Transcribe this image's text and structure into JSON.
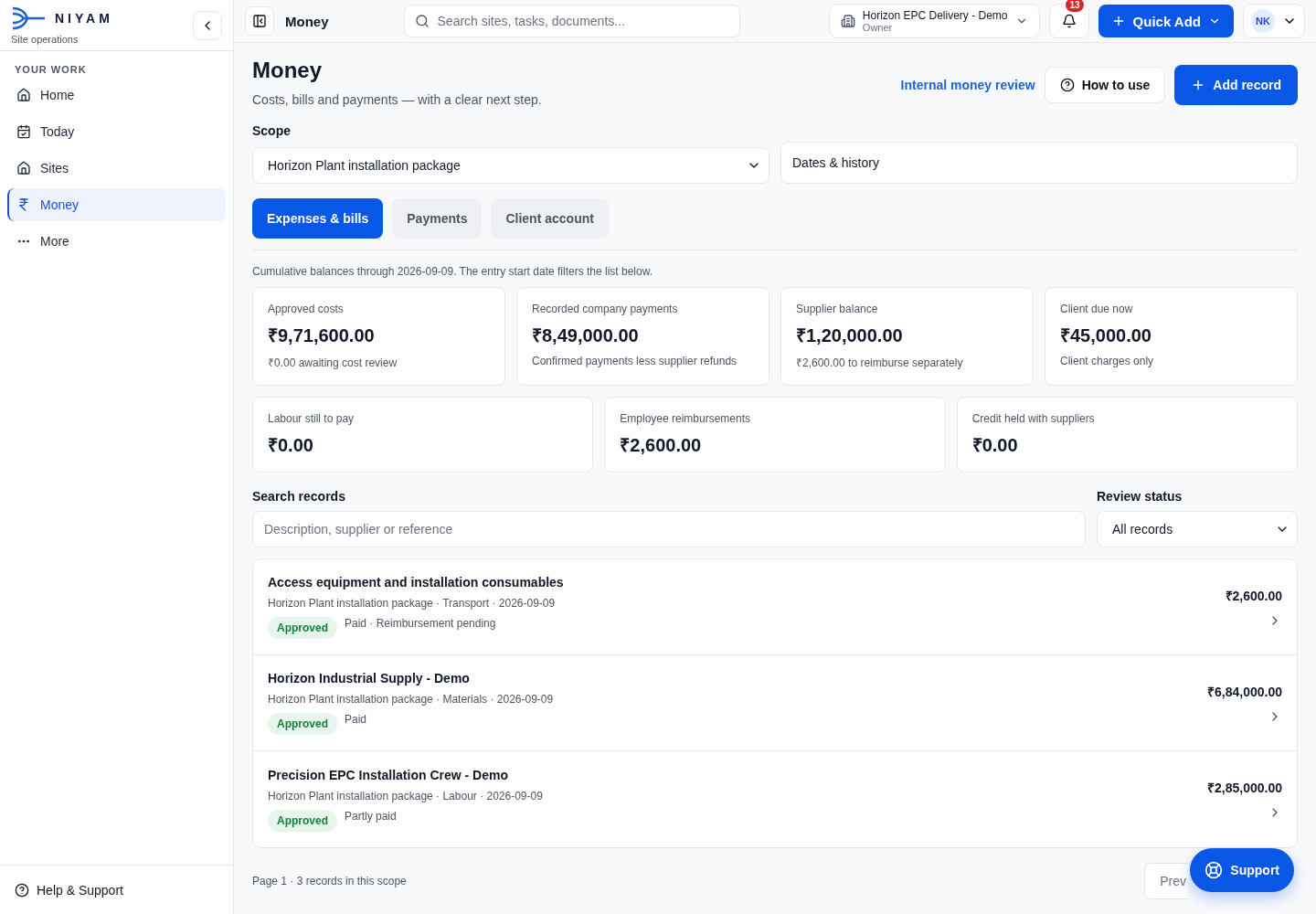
{
  "brand": {
    "name": "NIYAM",
    "subtitle": "Site operations"
  },
  "sidebar": {
    "section": "YOUR WORK",
    "items": [
      {
        "kind": "home",
        "label": "Home",
        "selected": false
      },
      {
        "kind": "calendar",
        "label": "Today",
        "selected": false
      },
      {
        "kind": "home",
        "label": "Sites",
        "selected": false
      },
      {
        "kind": "rupee",
        "label": "Money",
        "selected": true
      },
      {
        "kind": "more",
        "label": "More",
        "selected": false
      }
    ],
    "footer": "Help & Support"
  },
  "topbar": {
    "title": "Money",
    "search_placeholder": "Search sites, tasks, documents...",
    "org": {
      "name": "Horizon EPC Delivery - Demo",
      "role": "Owner"
    },
    "notifications": "13",
    "quick_add": "Quick Add",
    "avatar": "NK"
  },
  "page": {
    "title": "Money",
    "subtitle": "Costs, bills and payments — with a clear next step.",
    "link": "Internal money review",
    "help_button": "How to use",
    "add_button": "Add record"
  },
  "scope": {
    "label": "Scope",
    "value": "Horizon Plant installation package",
    "dates": "Dates & history"
  },
  "tabs": [
    {
      "label": "Expenses & bills",
      "selected": true
    },
    {
      "label": "Payments",
      "selected": false
    },
    {
      "label": "Client account",
      "selected": false
    }
  ],
  "note": "Cumulative balances through 2026-09-09. The entry start date filters the list below.",
  "stats": [
    {
      "label": "Approved costs",
      "value": "₹9,71,600.00",
      "sub": "₹0.00 awaiting cost review"
    },
    {
      "label": "Recorded company payments",
      "value": "₹8,49,000.00",
      "sub": "Confirmed payments less supplier refunds"
    },
    {
      "label": "Supplier balance",
      "value": "₹1,20,000.00",
      "sub": "₹2,600.00 to reimburse separately"
    },
    {
      "label": "Client due now",
      "value": "₹45,000.00",
      "sub": "Client charges only"
    }
  ],
  "stats_2": [
    {
      "label": "Labour still to pay",
      "value": "₹0.00"
    },
    {
      "label": "Employee reimbursements",
      "value": "₹2,600.00"
    },
    {
      "label": "Credit held with suppliers",
      "value": "₹0.00"
    }
  ],
  "filters": {
    "search_label": "Search records",
    "search_placeholder": "Description, supplier or reference",
    "status_label": "Review status",
    "status_value": "All records"
  },
  "records": [
    {
      "title": "Access equipment and installation consumables",
      "meta": "Horizon Plant installation package · Transport · 2026-09-09",
      "status": "Approved",
      "payment": "Paid · Reimbursement pending",
      "amount": "₹2,600.00"
    },
    {
      "title": "Horizon Industrial Supply - Demo",
      "meta": "Horizon Plant installation package · Materials · 2026-09-09",
      "status": "Approved",
      "payment": "Paid",
      "amount": "₹6,84,000.00"
    },
    {
      "title": "Precision EPC Installation Crew - Demo",
      "meta": "Horizon Plant installation package · Labour · 2026-09-09",
      "status": "Approved",
      "payment": "Partly paid",
      "amount": "₹2,85,000.00"
    }
  ],
  "pager": {
    "info": "Page 1 · 3 records in this scope",
    "prev": "Prev"
  },
  "support": "Support"
}
